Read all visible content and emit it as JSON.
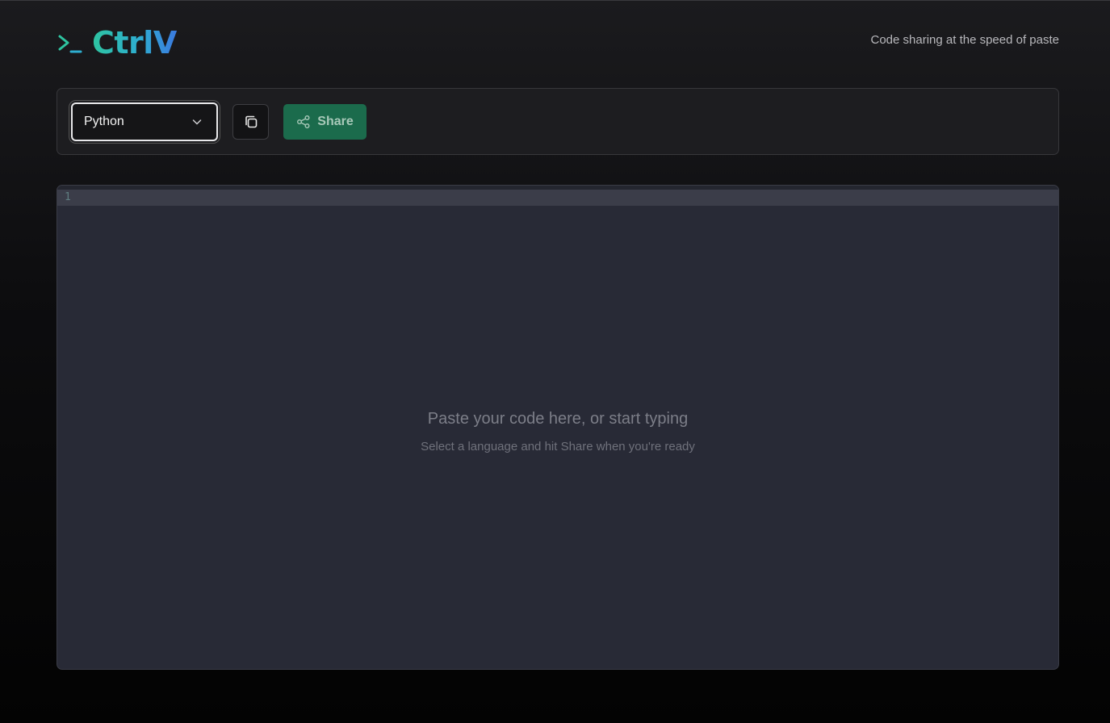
{
  "header": {
    "logo_text": "CtrlV",
    "logo_icon": "terminal-prompt-icon",
    "tagline": "Code sharing at the speed of paste"
  },
  "toolbar": {
    "language": {
      "selected": "Python",
      "icon": "chevron-down-icon"
    },
    "copy_button": {
      "icon": "copy-icon"
    },
    "share_button": {
      "label": "Share",
      "icon": "share-icon"
    }
  },
  "editor": {
    "line_numbers": [
      "1"
    ],
    "placeholder_title": "Paste your code here, or start typing",
    "placeholder_subtitle": "Select a language and hit Share when you're ready"
  },
  "colors": {
    "accent_green": "#2ec4a0",
    "accent_blue": "#3b7ae0",
    "share_bg": "#1b6b4c",
    "editor_bg": "#282a36"
  }
}
